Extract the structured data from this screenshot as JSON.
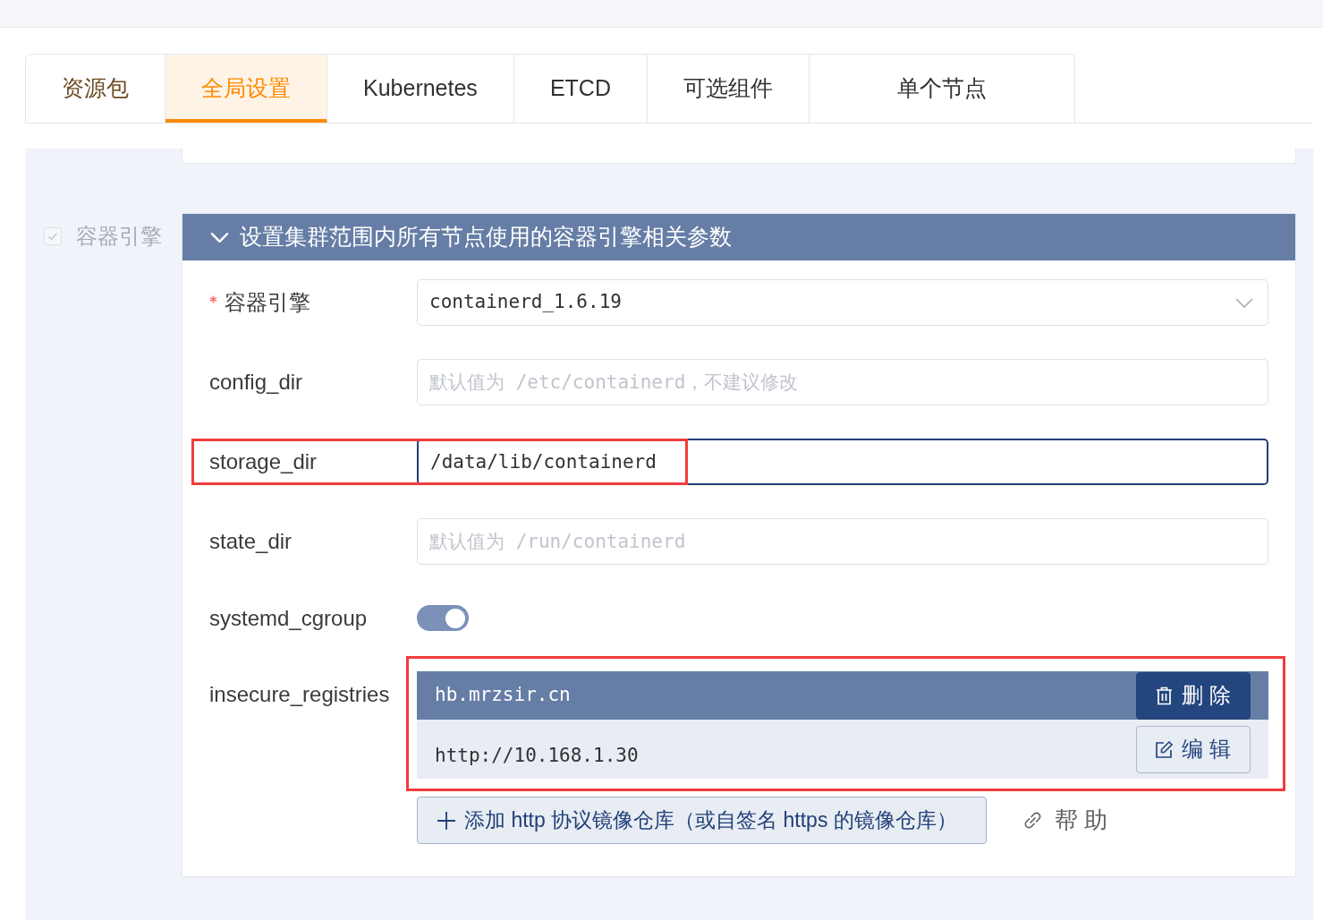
{
  "tabs": [
    {
      "label": "资源包",
      "selected": false,
      "hovered": true
    },
    {
      "label": "全局设置",
      "selected": true,
      "hovered": false
    },
    {
      "label": "Kubernetes",
      "selected": false,
      "hovered": false
    },
    {
      "label": "ETCD",
      "selected": false,
      "hovered": false
    },
    {
      "label": "可选组件",
      "selected": false,
      "hovered": false
    },
    {
      "label": "单个节点",
      "selected": false,
      "hovered": false
    }
  ],
  "section": {
    "toggle": {
      "label": "容器引擎",
      "checked": true,
      "disabled": true
    },
    "header": {
      "title": "设置集群范围内所有节点使用的容器引擎相关参数",
      "expanded": true
    },
    "fields": [
      {
        "kind": "select",
        "label": "容器引擎",
        "required": true,
        "highlighted": false,
        "value": "containerd_1.6.19"
      },
      {
        "kind": "text",
        "label": "config_dir",
        "required": false,
        "highlighted": false,
        "focused": false,
        "placeholder": "默认值为 /etc/containerd，不建议修改"
      },
      {
        "kind": "text",
        "label": "storage_dir",
        "required": false,
        "highlighted": true,
        "focused": true,
        "value": "/data/lib/containerd"
      },
      {
        "kind": "text",
        "label": "state_dir",
        "required": false,
        "highlighted": false,
        "focused": false,
        "placeholder": "默认值为 /run/containerd"
      },
      {
        "kind": "switch",
        "label": "systemd_cgroup",
        "required": false,
        "highlighted": false,
        "on": true
      },
      {
        "kind": "list",
        "label": "insecure_registries",
        "required": false,
        "highlighted": true,
        "items": [
          {
            "address": "hb.mrzsir.cn",
            "selected": true,
            "button": {
              "kind": "delete",
              "label": "删 除"
            }
          },
          {
            "address": "http://10.168.1.30",
            "selected": false,
            "button": {
              "kind": "edit",
              "label": "编 辑"
            }
          }
        ],
        "add_button": {
          "label": "添加 http 协议镜像仓库（或自签名 https 的镜像仓库）"
        },
        "help_link": {
          "label": "帮 助"
        }
      }
    ]
  }
}
